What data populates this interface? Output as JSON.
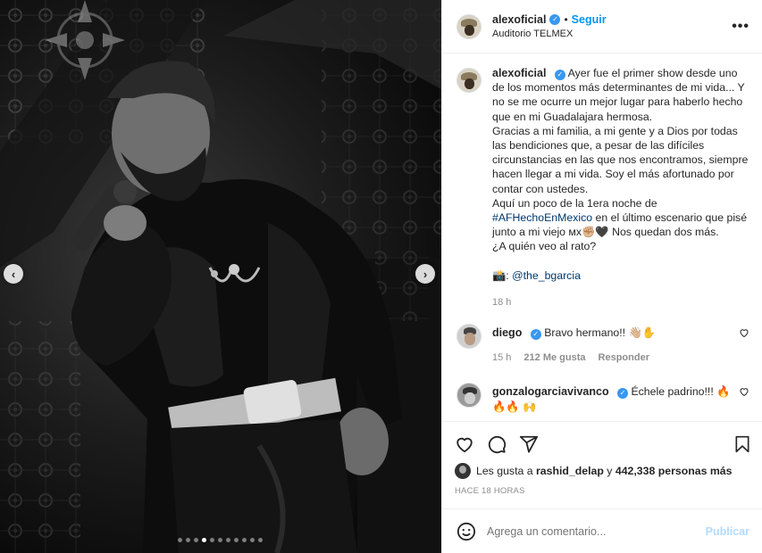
{
  "media": {
    "carousel_dots": 11,
    "active_dot": 3,
    "prev_icon": "chevron-left-icon",
    "next_icon": "chevron-right-icon",
    "prev_glyph": "‹",
    "next_glyph": "›"
  },
  "header": {
    "username": "alexoficial",
    "separator": "•",
    "follow_label": "Seguir",
    "location": "Auditorio TELMEX",
    "more_glyph": "•••"
  },
  "caption": {
    "username": "alexoficial",
    "lines": [
      "Ayer fue el primer show desde uno de los momentos más determinantes de mi vida... Y no se me ocurre un mejor lugar para haberlo hecho que en mi Guadalajara hermosa.",
      "Gracias a mi familia, a mi gente y a Dios por todas las bendiciones que, a pesar de las difíciles circunstancias en las que nos encontramos, siempre hacen llegar a mi vida. Soy el más afortunado por contar con ustedes."
    ],
    "line3_prefix": "Aquí un poco de la 1era noche de",
    "hashtag": "#AFHechoEnMexico",
    "line3_suffix": "en el último escenario que pisé junto a mi viejo ᴍx✊🏼🖤 Nos quedan dos más.",
    "line4": "¿A quién veo al rato?",
    "credit_prefix": "📸:",
    "credit_handle": "@the_bgarcia",
    "time": "18 h"
  },
  "comments": [
    {
      "username": "diego",
      "text": "Bravo hermano!! 👋🏼✋",
      "time": "15 h",
      "likes": "212 Me gusta",
      "reply": "Responder"
    },
    {
      "username": "gonzalogarciavivanco",
      "text": "Échele padrino!!! 🔥🔥🔥 🙌"
    }
  ],
  "likes_line": {
    "prefix": "Les gusta a",
    "user": "rashid_delap",
    "middle": "y",
    "count": "442,338 personas más"
  },
  "posted_time": "HACE 18 HORAS",
  "add_comment": {
    "placeholder": "Agrega un comentario...",
    "publish_label": "Publicar"
  },
  "colors": {
    "accent": "#0095f6",
    "verified": "#3897f0",
    "publish_disabled": "#b3dbff",
    "link": "#00376b"
  }
}
